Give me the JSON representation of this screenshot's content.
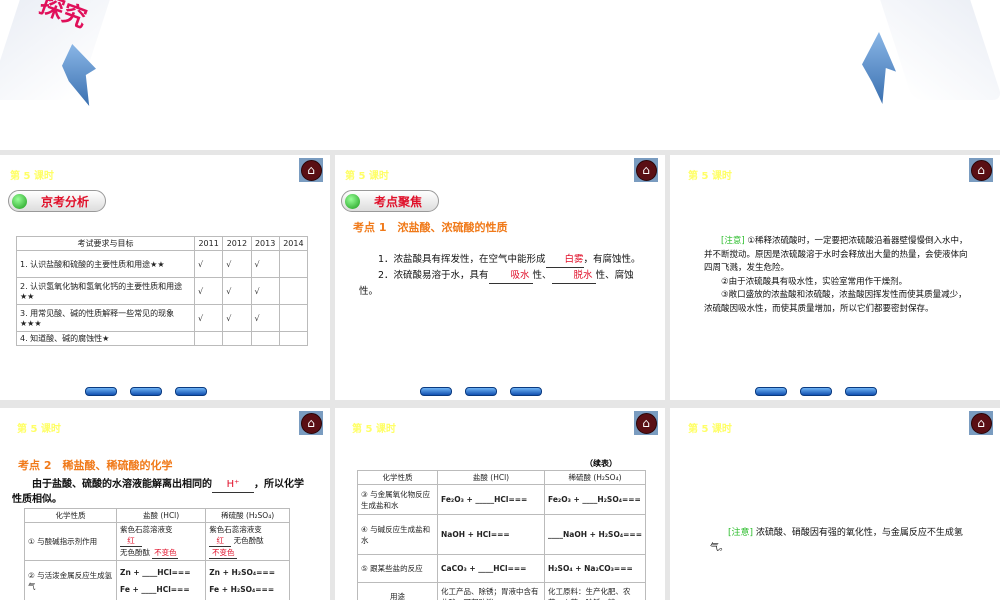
{
  "top_slide": {
    "title_fragment": "探究"
  },
  "slides": [
    {
      "lesson": "第 5 课时",
      "pill": "京考分析",
      "table": {
        "headers": [
          "考试要求与目标",
          "2011",
          "2012",
          "2013",
          "2014"
        ],
        "rows": [
          [
            "1. 认识盐酸和硫酸的主要性质和用途★★",
            "√",
            "√",
            "√",
            ""
          ],
          [
            "2. 认识氢氧化钠和氢氧化钙的主要性质和用途★★",
            "√",
            "√",
            "√",
            ""
          ],
          [
            "3. 用常见酸、碱的性质解释一些常见的现象★★★",
            "√",
            "√",
            "√",
            ""
          ],
          [
            "4. 知道酸、碱的腐蚀性★",
            "",
            "",
            "",
            ""
          ]
        ]
      }
    },
    {
      "lesson": "第 5 课时",
      "pill": "考点聚焦",
      "heading": "考点 1　浓盐酸、浓硫酸的性质",
      "p1a": "1．浓盐酸具有挥发性，在空气中能形成",
      "p1b": "白雾",
      "p1c": "，有腐蚀性。",
      "p2a": "2．浓硫酸易溶于水，具有",
      "p2b": "吸水",
      "p2c": "性、",
      "p2d": "脱水",
      "p2e": "性、腐蚀性。"
    },
    {
      "lesson": "第 5 课时",
      "note_label": "[注意]",
      "n1": "①稀释浓硫酸时，一定要把浓硫酸沿着器壁慢慢倒入水中，并不断搅动。原因是浓硫酸溶于水时会释放出大量的热量，会使液体向四周飞溅，发生危险。",
      "n2": "②由于浓硫酸具有吸水性，实验室常用作干燥剂。",
      "n3": "③敞口盛放的浓盐酸和浓硫酸，浓盐酸因挥发性而使其质量减少，浓硫酸因吸水性，而使其质量增加，所以它们都要密封保存。"
    },
    {
      "lesson": "第 5 课时",
      "heading": "考点 2　稀盐酸、稀硫酸的化学",
      "pa": "由于盐酸、硫酸的水溶液能解离出相同的",
      "pb": "H⁺",
      "pc": "，所以化学性质相似。",
      "headers": [
        "化学性质",
        "盐酸 (HCl)",
        "稀硫酸 (H₂SO₄)"
      ],
      "r1": {
        "prop": "① 与酸碱指示剂作用",
        "hcl1": "紫色石蕊溶液变",
        "hcl1b": "红",
        "hcl2": "无色酚酞",
        "hcl2b": "不变色",
        "h2so41": "紫色石蕊溶液变",
        "h2so41b": "红",
        "h2so42": "无色酚酞",
        "h2so42b": "不变色"
      },
      "r2": {
        "prop": "② 与活泼金属反应生成氢气",
        "hcl1": "Zn + ____HCl===",
        "hcl2": "Fe + ____HCl===",
        "h1": "Zn + H₂SO₄===",
        "h2": "Fe + H₂SO₄==="
      }
    },
    {
      "lesson": "第 5 课时",
      "cont": "（续表）",
      "headers": [
        "化学性质",
        "盐酸 (HCl)",
        "稀硫酸 (H₂SO₄)"
      ],
      "rows": [
        [
          "③ 与金属氧化物反应生成盐和水",
          "Fe₂O₃ + _____HCl===",
          "Fe₂O₃ + ____H₂SO₄==="
        ],
        [
          "④ 与碱反应生成盐和水",
          "NaOH + HCl===",
          "____NaOH + H₂SO₄==="
        ],
        [
          "⑤ 跟某些盐的反应",
          "CaCO₃ + ____HCl===",
          "H₂SO₄ + Na₂CO₃==="
        ],
        [
          "用途",
          "化工产品、除锈；胃液中含有盐酸，可帮助消",
          "化工原料：生产化肥、农药、火药；除锈、精"
        ]
      ]
    },
    {
      "lesson": "第 5 课时",
      "note_label": "[注意]",
      "note": "浓硫酸、硝酸因有强的氧化性，与金属反应不生成氢气。"
    }
  ]
}
